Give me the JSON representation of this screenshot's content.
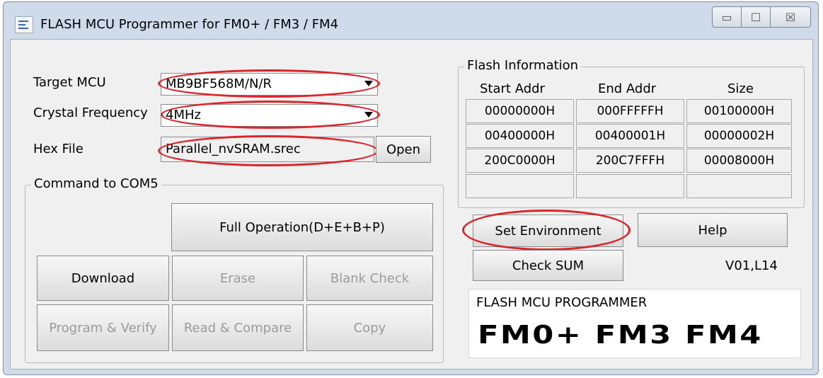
{
  "window": {
    "title": "FLASH MCU Programmer for FM0+ / FM3 / FM4",
    "controls": {
      "minimize": "▭",
      "maximize": "☐",
      "close": "☒"
    }
  },
  "form": {
    "target_mcu": {
      "label": "Target MCU",
      "value": "MB9BF568M/N/R"
    },
    "crystal_frequency": {
      "label": "Crystal Frequency",
      "value": "4MHz"
    },
    "hex_file": {
      "label": "Hex File",
      "value": "Parallel_nvSRAM.srec",
      "open_label": "Open"
    }
  },
  "command_group": {
    "caption": "Command to COM5",
    "full_operation": "Full Operation(D+E+B+P)",
    "download": "Download",
    "erase": "Erase",
    "blank_check": "Blank Check",
    "program_verify": "Program & Verify",
    "read_compare": "Read & Compare",
    "copy": "Copy"
  },
  "flash_info": {
    "caption": "Flash Information",
    "headers": [
      "Start Addr",
      "End Addr",
      "Size"
    ],
    "rows": [
      [
        "00000000H",
        "000FFFFFH",
        "00100000H"
      ],
      [
        "00400000H",
        "00400001H",
        "00000002H"
      ],
      [
        "200C0000H",
        "200C7FFFH",
        "00008000H"
      ],
      [
        "",
        "",
        ""
      ]
    ]
  },
  "buttons": {
    "set_environment": "Set Environment",
    "help": "Help",
    "check_sum": "Check SUM"
  },
  "version": "V01,L14",
  "brand": {
    "heading": "FLASH MCU PROGRAMMER",
    "logos": "FM0+  FM3  FM4"
  },
  "colors": {
    "highlight": "#d9262c"
  }
}
